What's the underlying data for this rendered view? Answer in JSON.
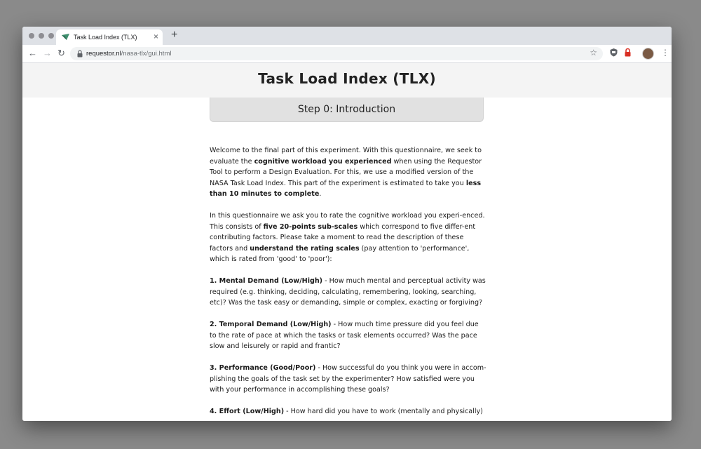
{
  "browser": {
    "tab_title": "Task Load Index (TLX)",
    "tab_close": "×",
    "new_tab": "+",
    "url_host": "requestor.nl",
    "url_path": "/nasa-tlx/gui.html",
    "icons": [
      "back-icon",
      "forward-icon",
      "reload-icon",
      "lock-icon",
      "star-icon",
      "shield-extension-icon",
      "lock-extension-icon",
      "avatar",
      "menu-icon"
    ]
  },
  "page": {
    "title": "Task Load Index (TLX)",
    "step_title": "Step 0: Introduction"
  },
  "intro": {
    "p1_a": "Welcome to the final part of this experiment. With this questionnaire, we seek to evaluate the ",
    "p1_b": "cognitive workload you experienced",
    "p1_c": " when using the Requestor Tool to perform a Design Evaluation. For this, we use a modified version of the NASA Task Load Index. This part of the experiment is estimated to take you ",
    "p1_d": "less than 10 minutes to complete",
    "p1_e": ".",
    "p2_a": "In this questionnaire we ask you to rate the cognitive workload you experi-enced. This consists of ",
    "p2_b": "five 20-points sub-scales",
    "p2_c": " which correspond to five differ-ent contributing factors. Please take a moment to read the description of these factors and ",
    "p2_d": "understand the rating scales",
    "p2_e": " (pay attention to 'performance', which is rated from 'good' to 'poor'):"
  },
  "factors": [
    {
      "heading": "1. Mental Demand (Low/High)",
      "text": " - How much mental and perceptual activity was required (e.g. thinking, deciding, calculating, remembering, looking, searching, etc)? Was the task easy or demanding, simple or complex, exacting or forgiving?"
    },
    {
      "heading": "2. Temporal Demand (Low/High)",
      "text": " - How much time pressure did you feel due to the rate of pace at which the tasks or task elements occurred? Was the pace slow and leisurely or rapid and frantic?"
    },
    {
      "heading": "3. Performance (Good/Poor)",
      "text": " - How successful do you think you were in accom-plishing the goals of the task set by the experimenter? How satisfied were you with your performance in accomplishing these goals?"
    },
    {
      "heading": "4. Effort (Low/High)",
      "text": " - How hard did you have to work (mentally and physically)"
    }
  ],
  "colors": {
    "page_background": "#ffffff",
    "header_background": "#f4f4f4",
    "step_background": "#e1e1e1",
    "tabstrip": "#dee1e6"
  }
}
